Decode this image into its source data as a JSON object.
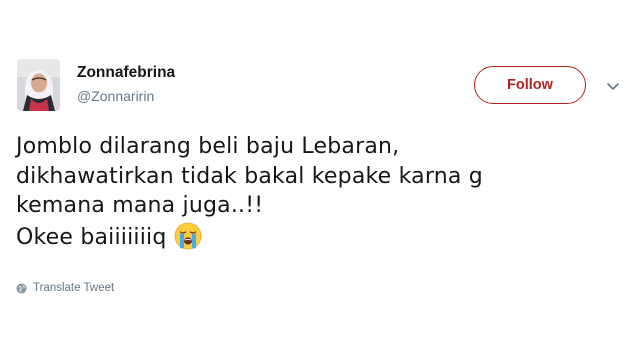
{
  "user": {
    "display_name": "Zonnafebrina",
    "handle": "@Zonnaririn"
  },
  "follow_button": {
    "label": "Follow",
    "color": "#b0241f"
  },
  "menu_icon": "chevron-down-icon",
  "tweet": {
    "lines": [
      "Jomblo dilarang beli baju Lebaran,",
      "dikhawatirkan tidak bakal kepake karna g",
      "kemana mana juga..!!",
      "Okee baiiiiiiiq"
    ],
    "emoji": "loudly-crying-face"
  },
  "translate": {
    "label": "Translate Tweet",
    "icon": "globe-icon"
  },
  "colors": {
    "text": "#14171a",
    "secondary": "#657786"
  }
}
